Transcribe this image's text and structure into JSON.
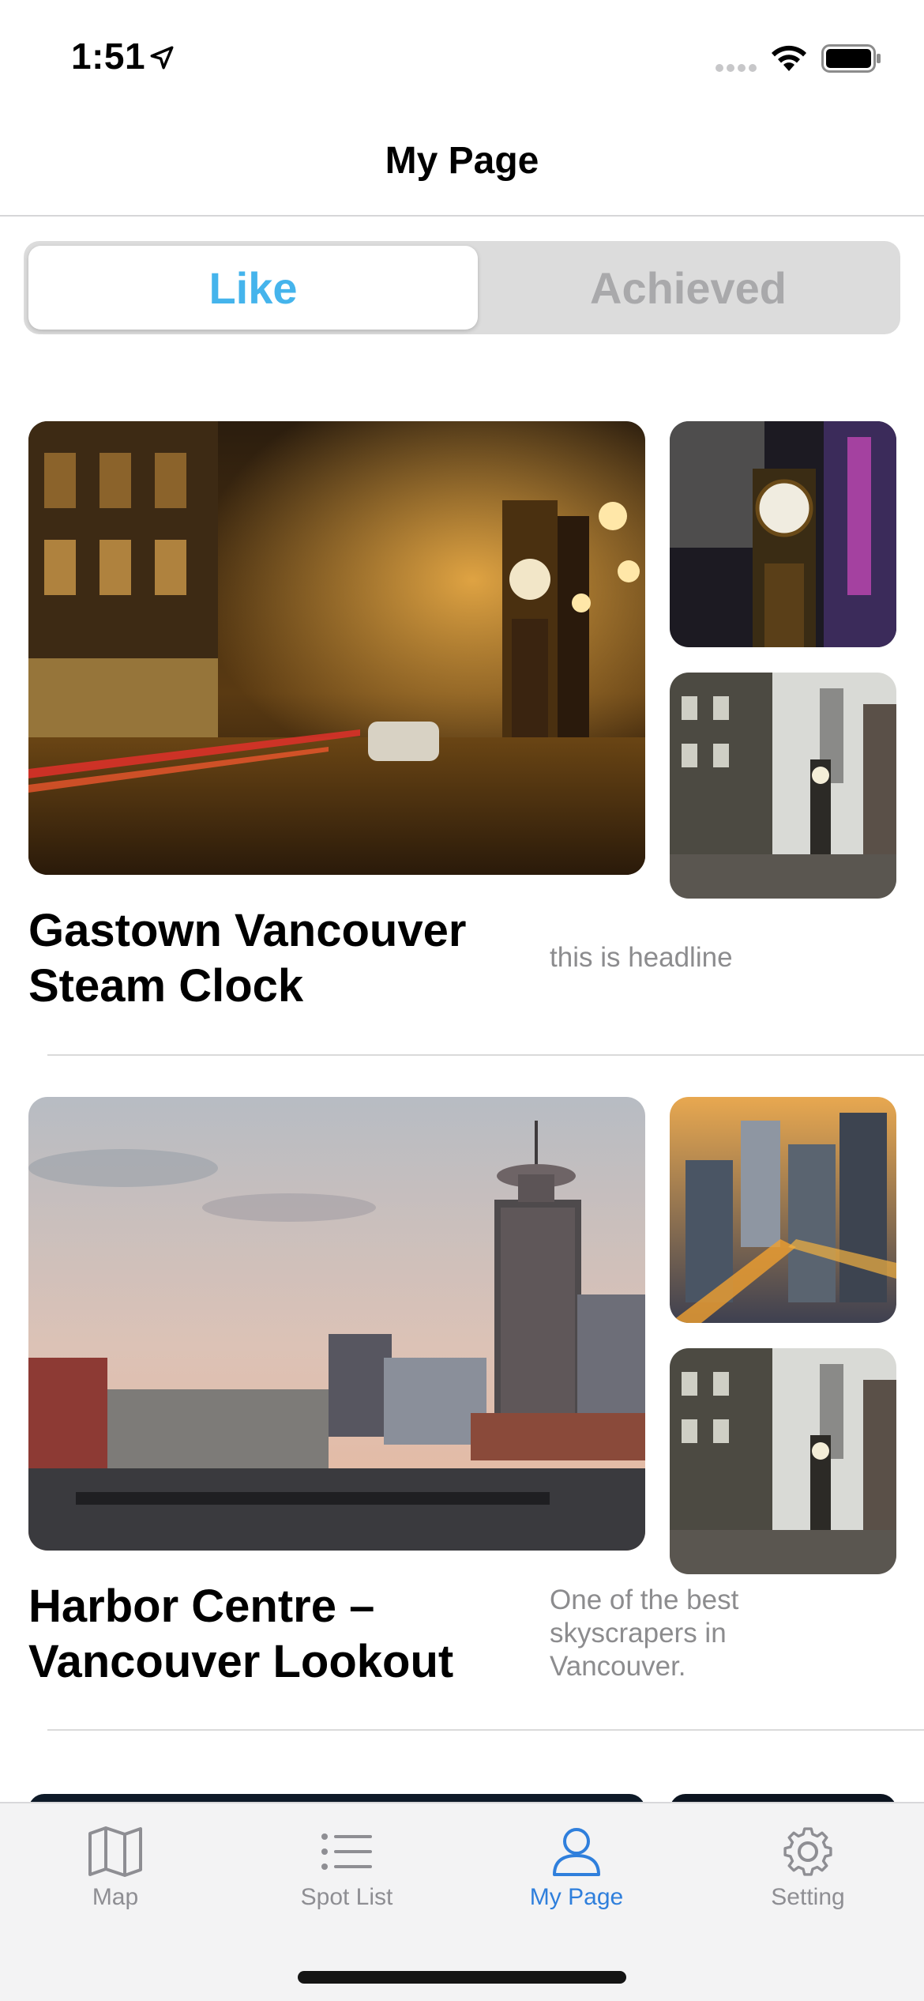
{
  "status_bar": {
    "time": "1:51"
  },
  "nav": {
    "title": "My Page"
  },
  "segmented": {
    "like": "Like",
    "achieved": "Achieved",
    "selected": "Like"
  },
  "cards": [
    {
      "title": "Gastown Vancouver Steam Clock",
      "headline": "this is headline"
    },
    {
      "title": "Harbor Centre – Vancouver Lookout",
      "headline": "One of the best skyscrapers in Vancouver."
    }
  ],
  "tab_bar": {
    "items": [
      {
        "label": "Map",
        "icon": "map-icon",
        "active": false
      },
      {
        "label": "Spot List",
        "icon": "list-icon",
        "active": false
      },
      {
        "label": "My Page",
        "icon": "person-icon",
        "active": true
      },
      {
        "label": "Setting",
        "icon": "gear-icon",
        "active": false
      }
    ]
  },
  "colors": {
    "accent": "#45b4ec",
    "tab_active": "#2f7fdc",
    "inactive": "#8e8e93"
  }
}
